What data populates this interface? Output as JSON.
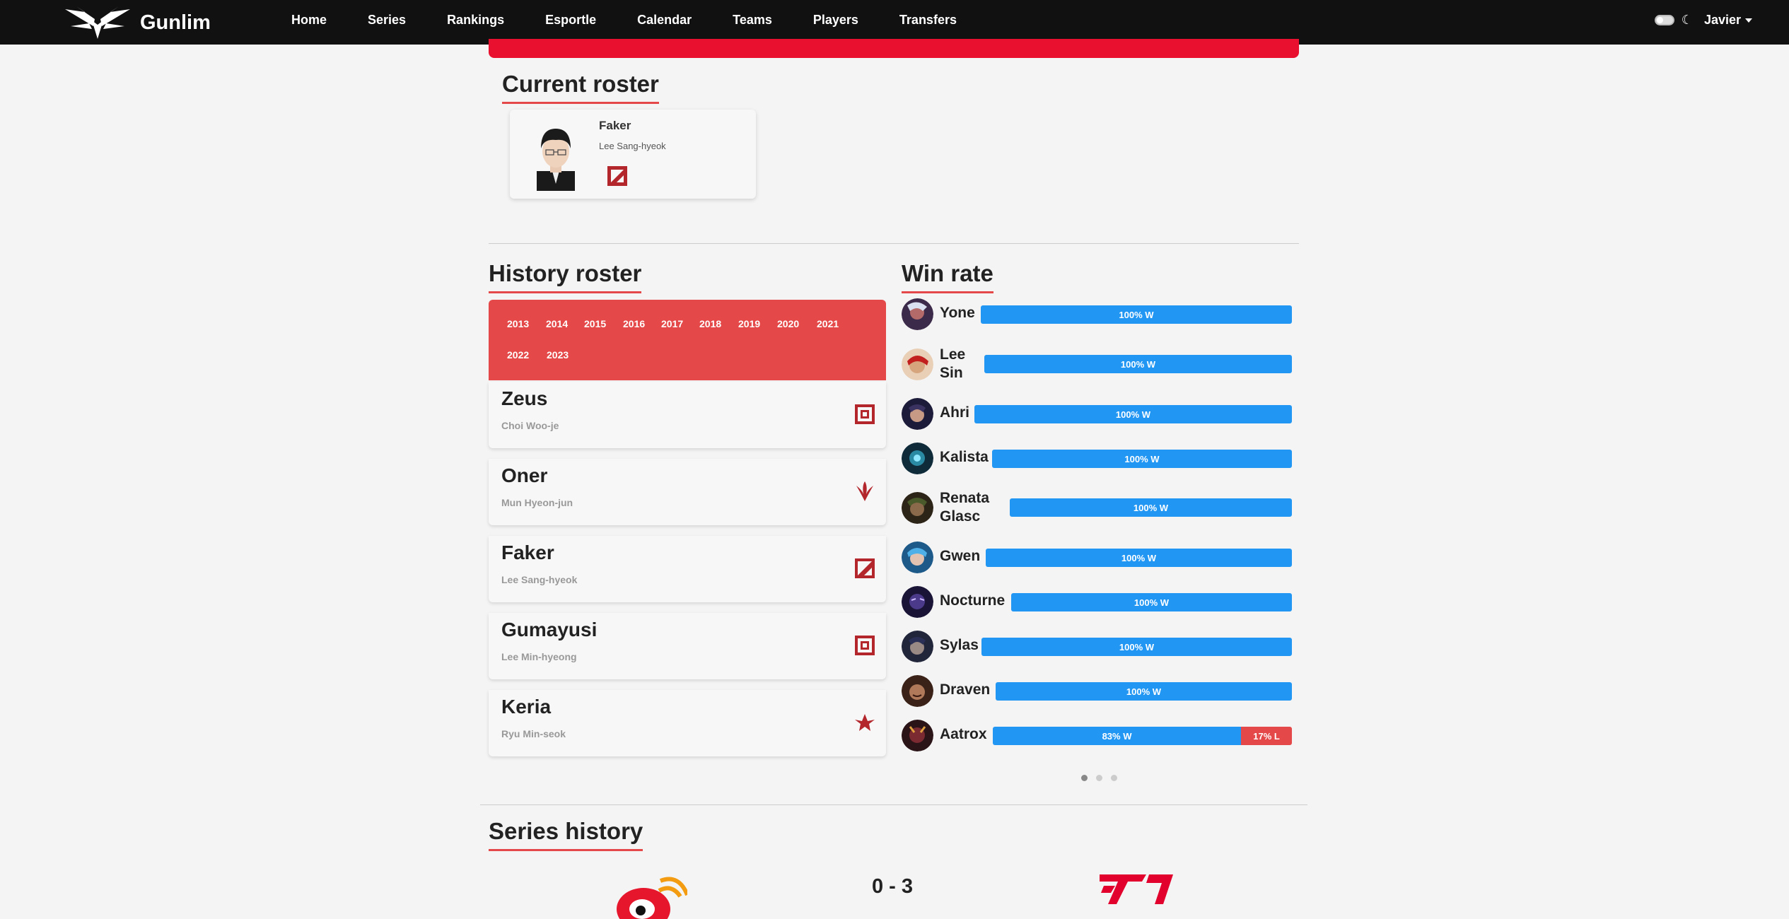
{
  "nav": {
    "brand": "Gunlim",
    "links": [
      "Home",
      "Series",
      "Rankings",
      "Esportle",
      "Calendar",
      "Teams",
      "Players",
      "Transfers"
    ],
    "user": "Javier"
  },
  "current_roster": {
    "title": "Current roster",
    "player": {
      "nick": "Faker",
      "name": "Lee Sang-hyeok",
      "team_icon": "t1-icon"
    }
  },
  "history_roster": {
    "title": "History roster",
    "years": [
      "2013",
      "2014",
      "2015",
      "2016",
      "2017",
      "2018",
      "2019",
      "2020",
      "2021",
      "2022",
      "2023"
    ],
    "players": [
      {
        "nick": "Zeus",
        "name": "Choi Woo-je",
        "team_icon": "hle-icon"
      },
      {
        "nick": "Oner",
        "name": "Mun Hyeon-jun",
        "team_icon": "t1-icon"
      },
      {
        "nick": "Faker",
        "name": "Lee Sang-hyeok",
        "team_icon": "t1-icon"
      },
      {
        "nick": "Gumayusi",
        "name": "Lee Min-hyeong",
        "team_icon": "hle-icon"
      },
      {
        "nick": "Keria",
        "name": "Ryu Min-seok",
        "team_icon": "t1-icon"
      }
    ]
  },
  "win_rate": {
    "title": "Win rate",
    "champions": [
      {
        "line1": "Yone",
        "line2": "",
        "win": 100,
        "win_label": "100% W",
        "loss_label": ""
      },
      {
        "line1": "Lee",
        "line2": "Sin",
        "win": 100,
        "win_label": "100% W",
        "loss_label": ""
      },
      {
        "line1": "Ahri",
        "line2": "",
        "win": 100,
        "win_label": "100% W",
        "loss_label": ""
      },
      {
        "line1": "Kalista",
        "line2": "",
        "win": 100,
        "win_label": "100% W",
        "loss_label": ""
      },
      {
        "line1": "Renata",
        "line2": "Glasc",
        "win": 100,
        "win_label": "100% W",
        "loss_label": ""
      },
      {
        "line1": "Gwen",
        "line2": "",
        "win": 100,
        "win_label": "100% W",
        "loss_label": ""
      },
      {
        "line1": "Nocturne",
        "line2": "",
        "win": 100,
        "win_label": "100% W",
        "loss_label": ""
      },
      {
        "line1": "Sylas",
        "line2": "",
        "win": 100,
        "win_label": "100% W",
        "loss_label": ""
      },
      {
        "line1": "Draven",
        "line2": "",
        "win": 100,
        "win_label": "100% W",
        "loss_label": ""
      },
      {
        "line1": "Aatrox",
        "line2": "",
        "win": 83,
        "win_label": "83% W",
        "loss_label": "17% L"
      }
    ],
    "pages": 3,
    "active_page": 1
  },
  "series_history": {
    "title": "Series history",
    "score": "0 - 3",
    "team_a_icon": "weibo-gaming-icon",
    "team_b_icon": "t1-icon"
  },
  "colors": {
    "accent": "#e44848",
    "banner": "#e8102e",
    "win": "#2196f3",
    "loss": "#e44848",
    "team_red": "#b3262c"
  }
}
